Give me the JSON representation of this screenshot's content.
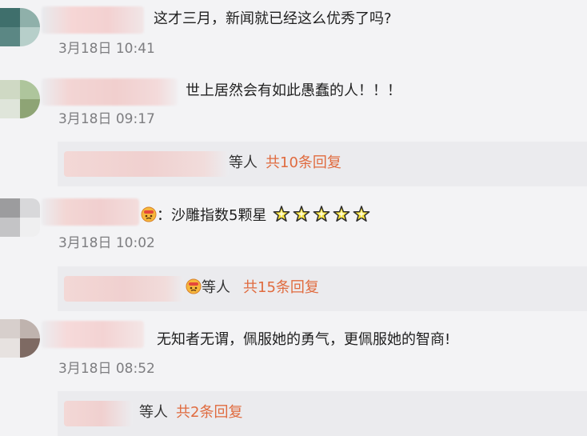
{
  "comments": [
    {
      "text": "这才三月，新闻就已经这么优秀了吗?",
      "time": "3月18日 10:41"
    },
    {
      "text": "世上居然会有如此愚蠢的人！！！",
      "time": "3月18日 09:17"
    },
    {
      "text_prefix": "：沙雕指数5颗星",
      "time": "3月18日 10:02",
      "star_count": 5
    },
    {
      "text": "无知者无谓，佩服她的勇气，更佩服她的智商!",
      "time": "3月18日 08:52"
    }
  ],
  "replies": [
    {
      "who": "等人",
      "count": "共10条回复"
    },
    {
      "who": "等人",
      "count": "共15条回复"
    },
    {
      "who": "等人",
      "count": "共2条回复"
    }
  ],
  "colors": {
    "accent": "#e06b3f",
    "time": "#7d7d80",
    "background": "#f3f3f5",
    "reply_background": "#ebebee"
  },
  "icons": {
    "comment_3_emoji": "angry-face-icon",
    "stars": "star-icon",
    "reply_2_emoji": "angry-face-icon"
  }
}
